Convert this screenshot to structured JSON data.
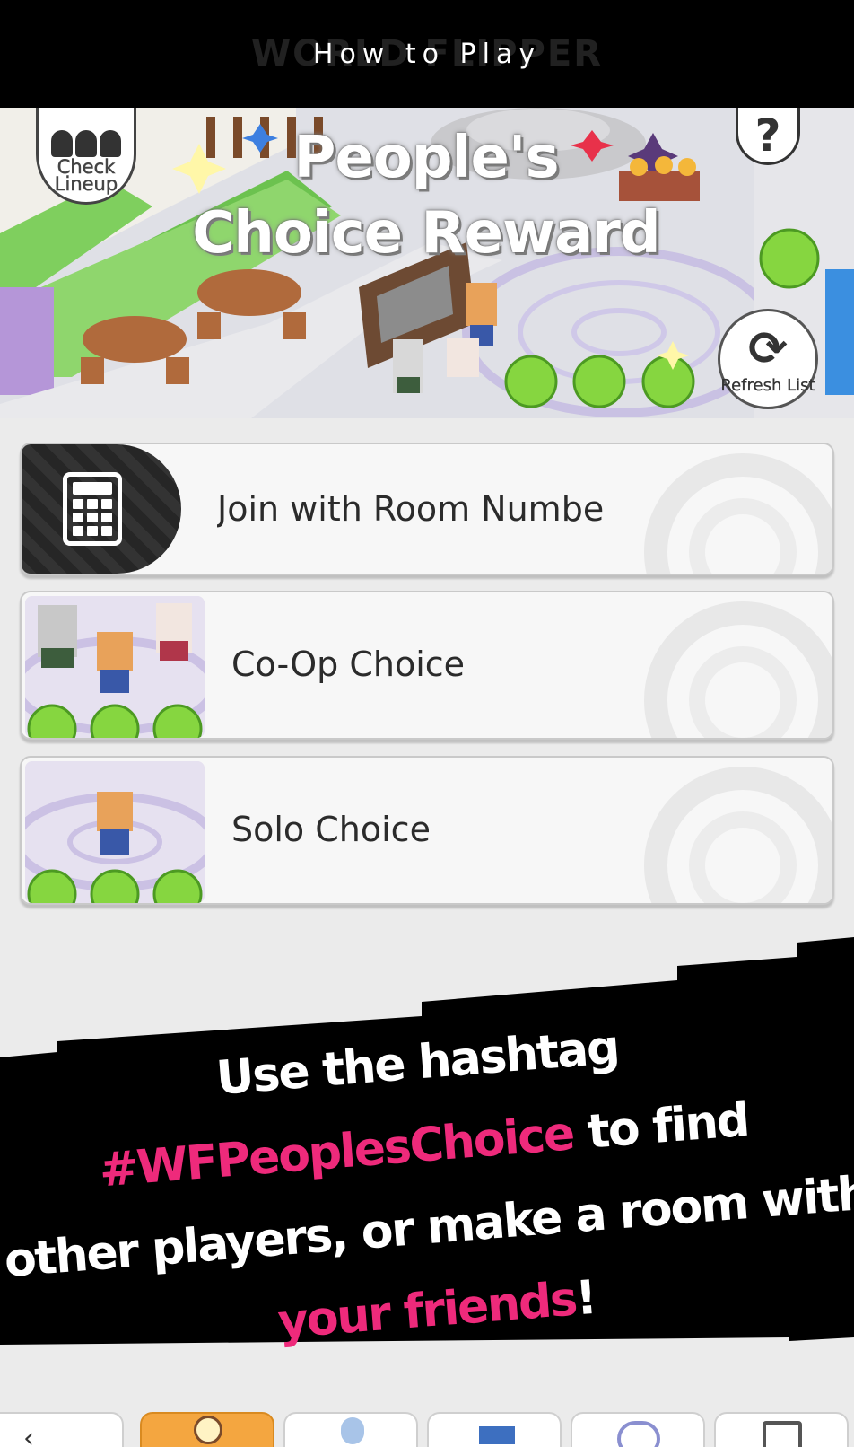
{
  "header": {
    "title": "How to Play",
    "watermark": "WORLD FLIPPER"
  },
  "banner": {
    "title_line1": "People's",
    "title_line2": "Choice Reward",
    "check_lineup_label": "Check Lineup",
    "help_label": "?",
    "refresh_label": "Refresh List"
  },
  "menu": {
    "join_label": "Join with Room Numbe",
    "coop_label": "Co-Op Choice",
    "solo_label": "Solo Choice"
  },
  "promo": {
    "line1": "Use the hashtag",
    "hashtag": "#WFPeoplesChoice",
    "line2_rest": " to find",
    "line3": "other players, or make a room with",
    "friends": "your friends",
    "exclaim": "!"
  },
  "colors": {
    "accent_pink": "#ee2a7b",
    "header_bg": "#000000",
    "tab_active": "#f4a640"
  },
  "icons": {
    "join": "calculator-icon",
    "refresh": "refresh-icon",
    "help": "question-icon",
    "lineup": "people-icon"
  }
}
